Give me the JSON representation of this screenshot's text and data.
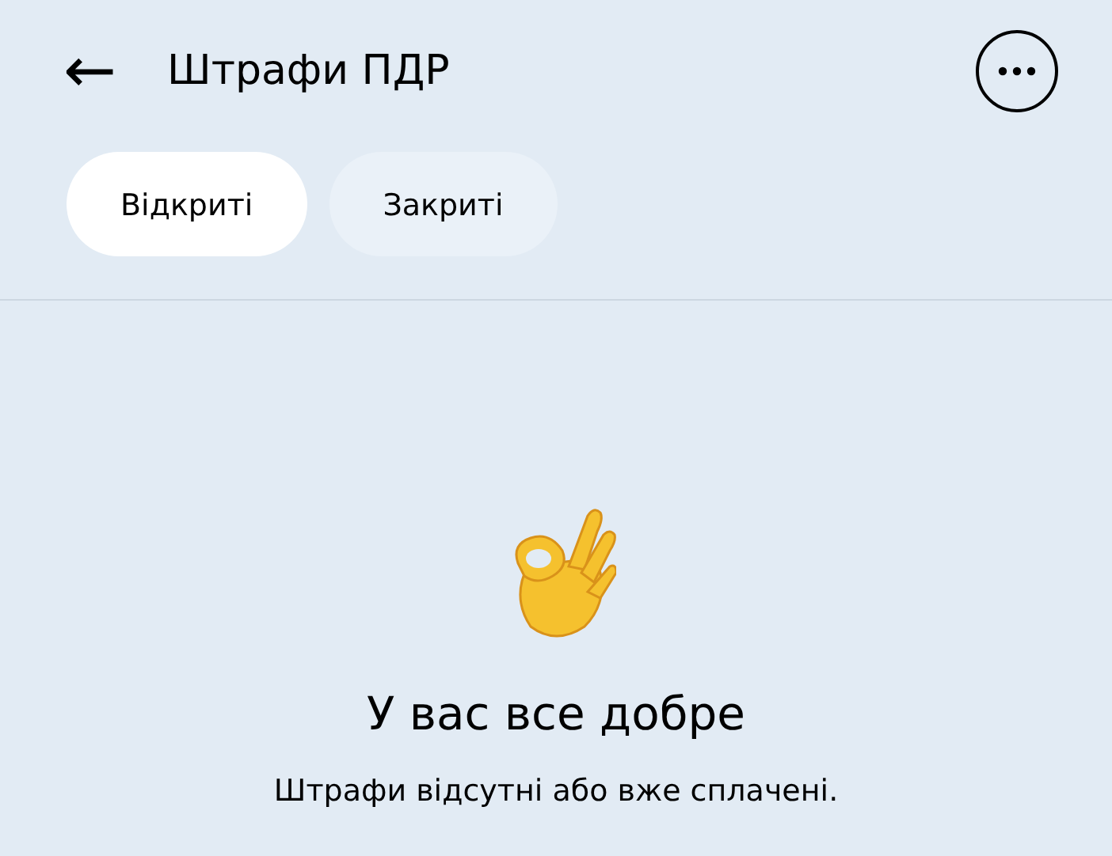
{
  "header": {
    "back": "←",
    "title": "Штрафи ПДР"
  },
  "tabs": [
    {
      "label": "Відкриті",
      "selected": true
    },
    {
      "label": "Закриті",
      "selected": false
    }
  ],
  "empty_state": {
    "title": "У вас все добре",
    "message": "Штрафи відсутні або вже сплачені."
  }
}
